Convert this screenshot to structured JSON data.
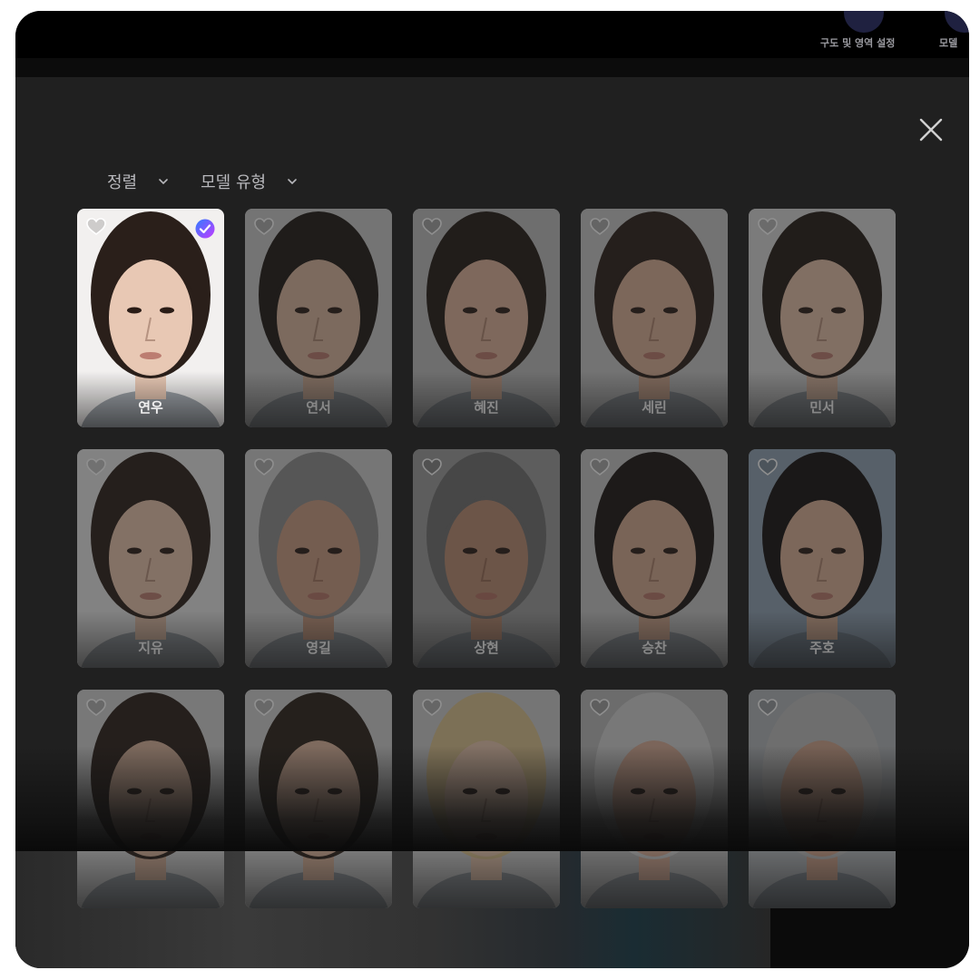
{
  "top_toolbar": {
    "items": [
      {
        "label": "구도 및 영역 설정"
      },
      {
        "label": "모델"
      }
    ]
  },
  "filters": [
    {
      "label": "정렬"
    },
    {
      "label": "모델 유형"
    }
  ],
  "models": [
    {
      "name": "연우",
      "selected": true,
      "skin": "#e8c8b4",
      "hair": "#2a1f1a",
      "bg": "#f2f0ef"
    },
    {
      "name": "연서",
      "selected": false,
      "skin": "#d8b49c",
      "hair": "#1e1814",
      "bg": "#c9c9c9"
    },
    {
      "name": "혜진",
      "selected": false,
      "skin": "#dcb198",
      "hair": "#231a15",
      "bg": "#bdbdbd"
    },
    {
      "name": "세린",
      "selected": false,
      "skin": "#d9ae94",
      "hair": "#2a1e18",
      "bg": "#c7c7c7"
    },
    {
      "name": "민서",
      "selected": false,
      "skin": "#e3bea6",
      "hair": "#231a15",
      "bg": "#d6d6d6"
    },
    {
      "name": "지유",
      "selected": false,
      "skin": "#e6c2aa",
      "hair": "#2b1f18",
      "bg": "#e4e4e4"
    },
    {
      "name": "영길",
      "selected": false,
      "skin": "#c99a80",
      "hair": "#8c8c8c",
      "bg": "#cdcdcd"
    },
    {
      "name": "상현",
      "selected": false,
      "skin": "#b88a70",
      "hair": "#6e6e6e",
      "bg": "#9b9b9b"
    },
    {
      "name": "승찬",
      "selected": false,
      "skin": "#d3a88e",
      "hair": "#1a1512",
      "bg": "#c4c4c4"
    },
    {
      "name": "주호",
      "selected": false,
      "skin": "#d8ae94",
      "hair": "#141110",
      "bg": "#8ea0b2"
    },
    {
      "name": "",
      "selected": false,
      "skin": "#d8b29a",
      "hair": "#2a1f19",
      "bg": "#d0d0d0"
    },
    {
      "name": "",
      "selected": false,
      "skin": "#ddb59c",
      "hair": "#2b2019",
      "bg": "#cfcfcf"
    },
    {
      "name": "",
      "selected": false,
      "skin": "#e6c4ac",
      "hair": "#d9c08c",
      "bg": "#cacaca"
    },
    {
      "name": "",
      "selected": false,
      "skin": "#d6ab95",
      "hair": "#d0d0d0",
      "bg": "#b8b8b8"
    },
    {
      "name": "",
      "selected": false,
      "skin": "#cfa28a",
      "hair": "#bdbdbd",
      "bg": "#b0b4b8"
    }
  ],
  "colors": {
    "panel_bg": "#202020",
    "check_gradient_start": "#2f7cff",
    "check_gradient_end": "#c43bff"
  },
  "icons": {
    "close": "close-icon",
    "favorite": "heart-icon",
    "selected": "check-circle-icon",
    "dropdown": "chevron-down-icon"
  }
}
